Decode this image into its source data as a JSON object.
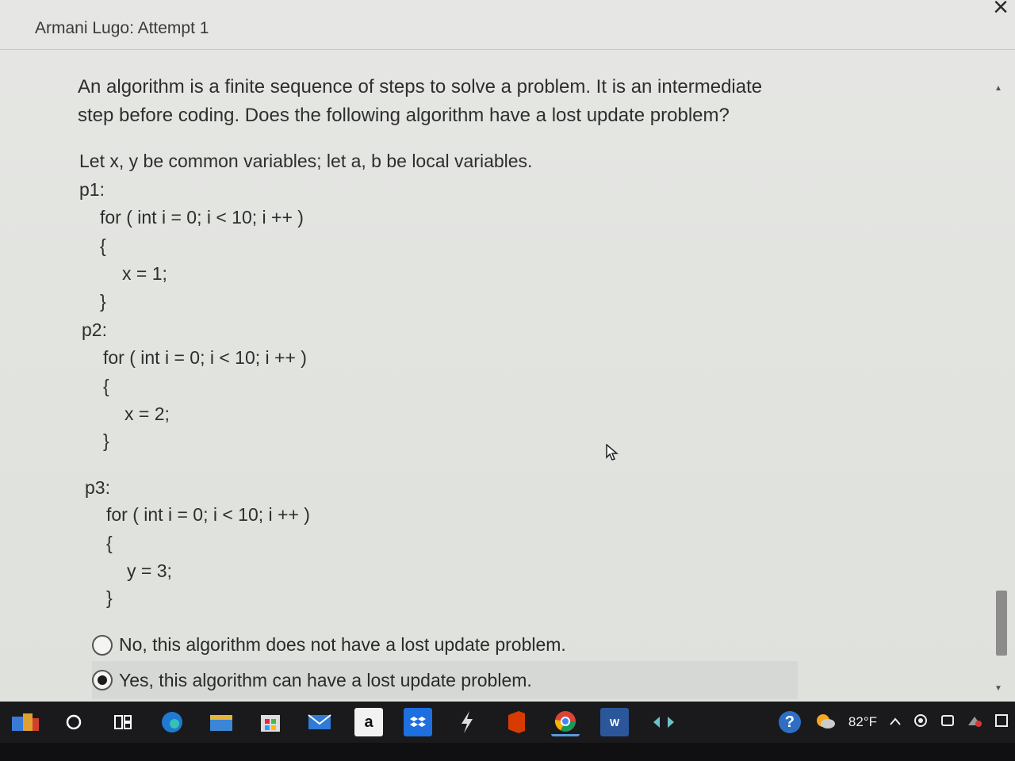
{
  "window": {
    "title": "Armani Lugo: Attempt 1",
    "close_glyph": "×"
  },
  "question": {
    "prompt": "An algorithm is a finite sequence of steps to solve a problem. It is an intermediate step before coding. Does the following algorithm have a lost update problem?",
    "preface": "Let x, y be common variables; let a, b be local variables."
  },
  "code": {
    "p1": {
      "label": "p1:",
      "loop": "for ( int i = 0; i < 10; i ++ )",
      "open": "{",
      "body": "x = 1;",
      "close": "}"
    },
    "p2": {
      "label": "p2:",
      "loop": "for ( int i = 0; i < 10; i ++ )",
      "open": "{",
      "body": "x = 2;",
      "close": "}"
    },
    "p3": {
      "label": "p3:",
      "loop": "for ( int i = 0; i < 10; i ++ )",
      "open": "{",
      "body": "y = 3;",
      "close": "}"
    }
  },
  "answers": [
    {
      "label": "No, this algorithm does not have a lost update problem.",
      "selected": false
    },
    {
      "label": "Yes, this algorithm can have a lost update problem.",
      "selected": true
    }
  ],
  "taskbar": {
    "icons": [
      "search-icon",
      "task-view-icon",
      "edge-icon",
      "file-explorer-icon",
      "store-icon",
      "mail-icon",
      "amazon-icon",
      "dropbox-icon",
      "shortcut-icon",
      "office-icon",
      "chrome-icon",
      "word-icon",
      "teams-icon"
    ],
    "amazon_glyph": "a",
    "word_glyph": "W",
    "weather_temp": "82°F",
    "help_glyph": "?"
  },
  "colors": {
    "screen_bg": "#e2e4e0",
    "taskbar_bg": "#1a1a1c",
    "selected_row": "#d6d8d5"
  }
}
